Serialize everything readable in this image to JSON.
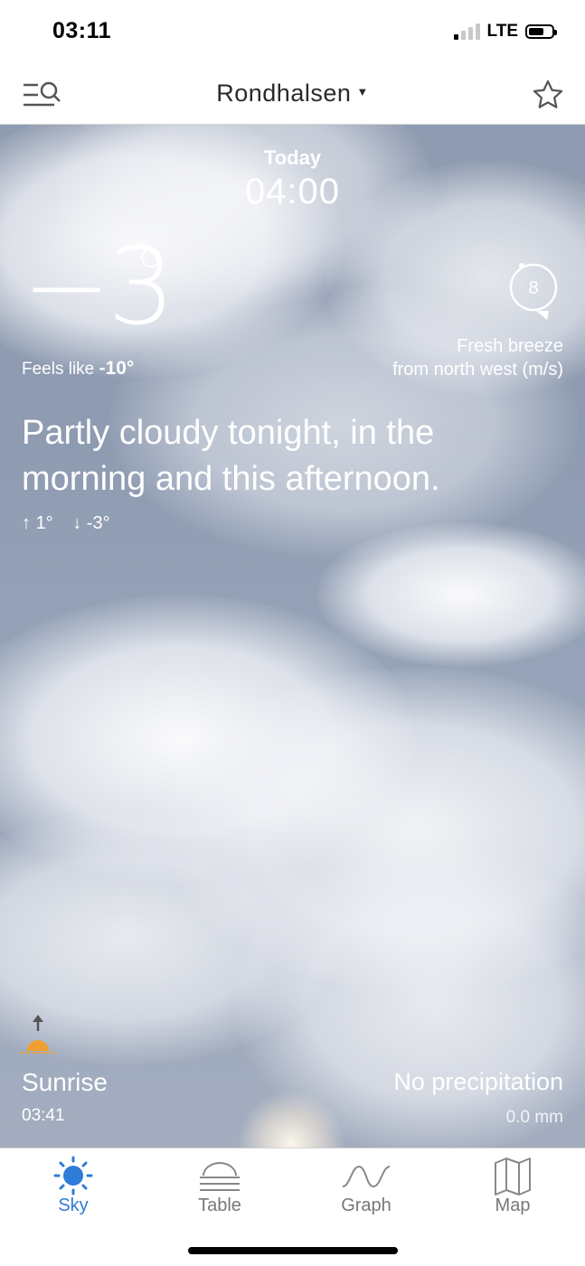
{
  "status_bar": {
    "time": "03:11",
    "network": "LTE",
    "signal_bars_active": 1,
    "signal_bars_total": 4,
    "battery_level": 0.6
  },
  "nav": {
    "location": "Rondhalsen"
  },
  "forecast": {
    "day": "Today",
    "time": "04:00",
    "temperature": "−3",
    "feels_like_label": "Feels like",
    "feels_like_value": "-10°",
    "wind_speed": "8",
    "wind_desc_line1": "Fresh breeze",
    "wind_desc_line2": "from north west (m/s)",
    "summary": "Partly cloudy tonight, in the morning and this afternoon.",
    "high": "↑ 1°",
    "low": "↓ -3°",
    "sunrise_label": "Sunrise",
    "sunrise_time": "03:41",
    "precip_label": "No precipitation",
    "precip_amount": "0.0 mm"
  },
  "tabs": [
    {
      "label": "Sky",
      "icon": "sun-icon",
      "active": true
    },
    {
      "label": "Table",
      "icon": "table-icon",
      "active": false
    },
    {
      "label": "Graph",
      "icon": "graph-icon",
      "active": false
    },
    {
      "label": "Map",
      "icon": "map-icon",
      "active": false
    }
  ],
  "colors": {
    "accent": "#2f7bd8",
    "sunrise_orange": "#f0a030",
    "sky_blue_gray": "#8f9bb0"
  }
}
